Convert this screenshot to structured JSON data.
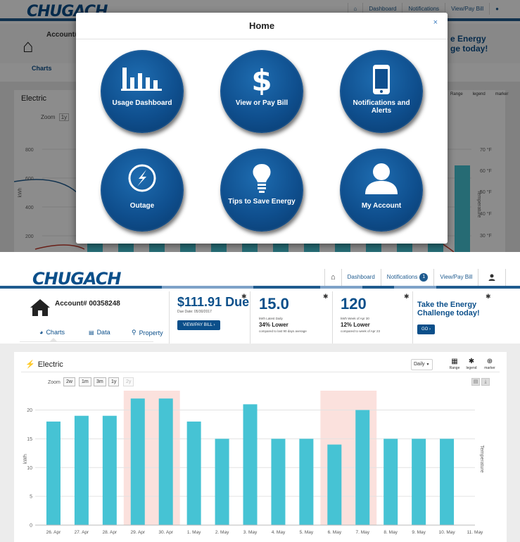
{
  "modal": {
    "title": "Home",
    "close": "×",
    "tiles": [
      {
        "label": "Usage Dashboard",
        "icon": "bar-chart-icon"
      },
      {
        "label": "View or Pay Bill",
        "icon": "dollar-icon"
      },
      {
        "label": "Notifications and Alerts",
        "icon": "phone-icon"
      },
      {
        "label": "Outage",
        "icon": "lightning-icon"
      },
      {
        "label": "Tips to Save Energy",
        "icon": "lightbulb-icon"
      },
      {
        "label": "My Account",
        "icon": "person-icon"
      }
    ]
  },
  "background": {
    "logo": "CHUGACH",
    "account": "Account#",
    "challenge_line1": "e Energy",
    "challenge_line2": "ge today!",
    "charts": "Charts",
    "electric": "Electric",
    "zoom": "Zoom",
    "zoom_1y": "1y",
    "nav_dashboard": "Dashboard",
    "nav_notifications": "Notifications",
    "nav_paybill": "View/Pay Bill",
    "tool_range": "Range",
    "tool_legend": "legend",
    "tool_marker": "marker",
    "y_ticks": [
      "800",
      "600",
      "400",
      "200"
    ],
    "y_unit": "kWh",
    "temp_ticks": [
      "70 °F",
      "60 °F",
      "50 °F",
      "40 °F",
      "30 °F"
    ],
    "temp_unit": "Temperature"
  },
  "nav": {
    "logo": "CHUGACH",
    "dashboard": "Dashboard",
    "notifications": "Notifications",
    "notifications_count": "1",
    "pay_bill": "View/Pay Bill"
  },
  "account": {
    "label": "Account# 00358248",
    "tabs": [
      "Charts",
      "Data",
      "Property"
    ]
  },
  "bill": {
    "amount": "$111.91 Due",
    "due_date": "Due Date: 05/30/2017",
    "button": "VIEW/PAY BILL ›"
  },
  "daily_metric": {
    "value": "15.0",
    "caption": "kWh Latest Daily",
    "change": "34% Lower",
    "compare": "compared to last 90 days average"
  },
  "weekly_metric": {
    "value": "120",
    "caption": "kWh Week of Apr 30",
    "change": "12% Lower",
    "compare": "compared to week of Apr 23"
  },
  "challenge": {
    "line1": "Take the Energy",
    "line2": "Challenge today!",
    "button": "GO ›"
  },
  "card": {
    "title": "Electric",
    "interval": "Daily",
    "tools": {
      "range": "Range",
      "legend": "legend",
      "marker": "marker"
    },
    "zoom_label": "Zoom",
    "zoom_options": [
      "2w",
      "1m",
      "3m",
      "1y",
      "2y"
    ]
  },
  "colors": {
    "brand": "#0b4f8a",
    "bar": "#46c3d4",
    "highlight": "#fbe1dd"
  },
  "chart_data": {
    "type": "bar",
    "categories": [
      "26. Apr",
      "27. Apr",
      "28. Apr",
      "29. Apr",
      "30. Apr",
      "1. May",
      "2. May",
      "3. May",
      "4. May",
      "5. May",
      "6. May",
      "7. May",
      "8. May",
      "9. May",
      "10. May",
      "11. May"
    ],
    "values": [
      18,
      19,
      19,
      22,
      22,
      18,
      15,
      21,
      15,
      15,
      14,
      20,
      15,
      15,
      15
    ],
    "ylabel": "kWh",
    "y2label": "Temperature",
    "ylim": [
      0,
      23
    ],
    "yticks": [
      0,
      5,
      10,
      15,
      20
    ],
    "highlight_ranges": [
      [
        "29. Apr",
        "30. Apr"
      ],
      [
        "6. May",
        "7. May"
      ]
    ],
    "grid": true
  }
}
